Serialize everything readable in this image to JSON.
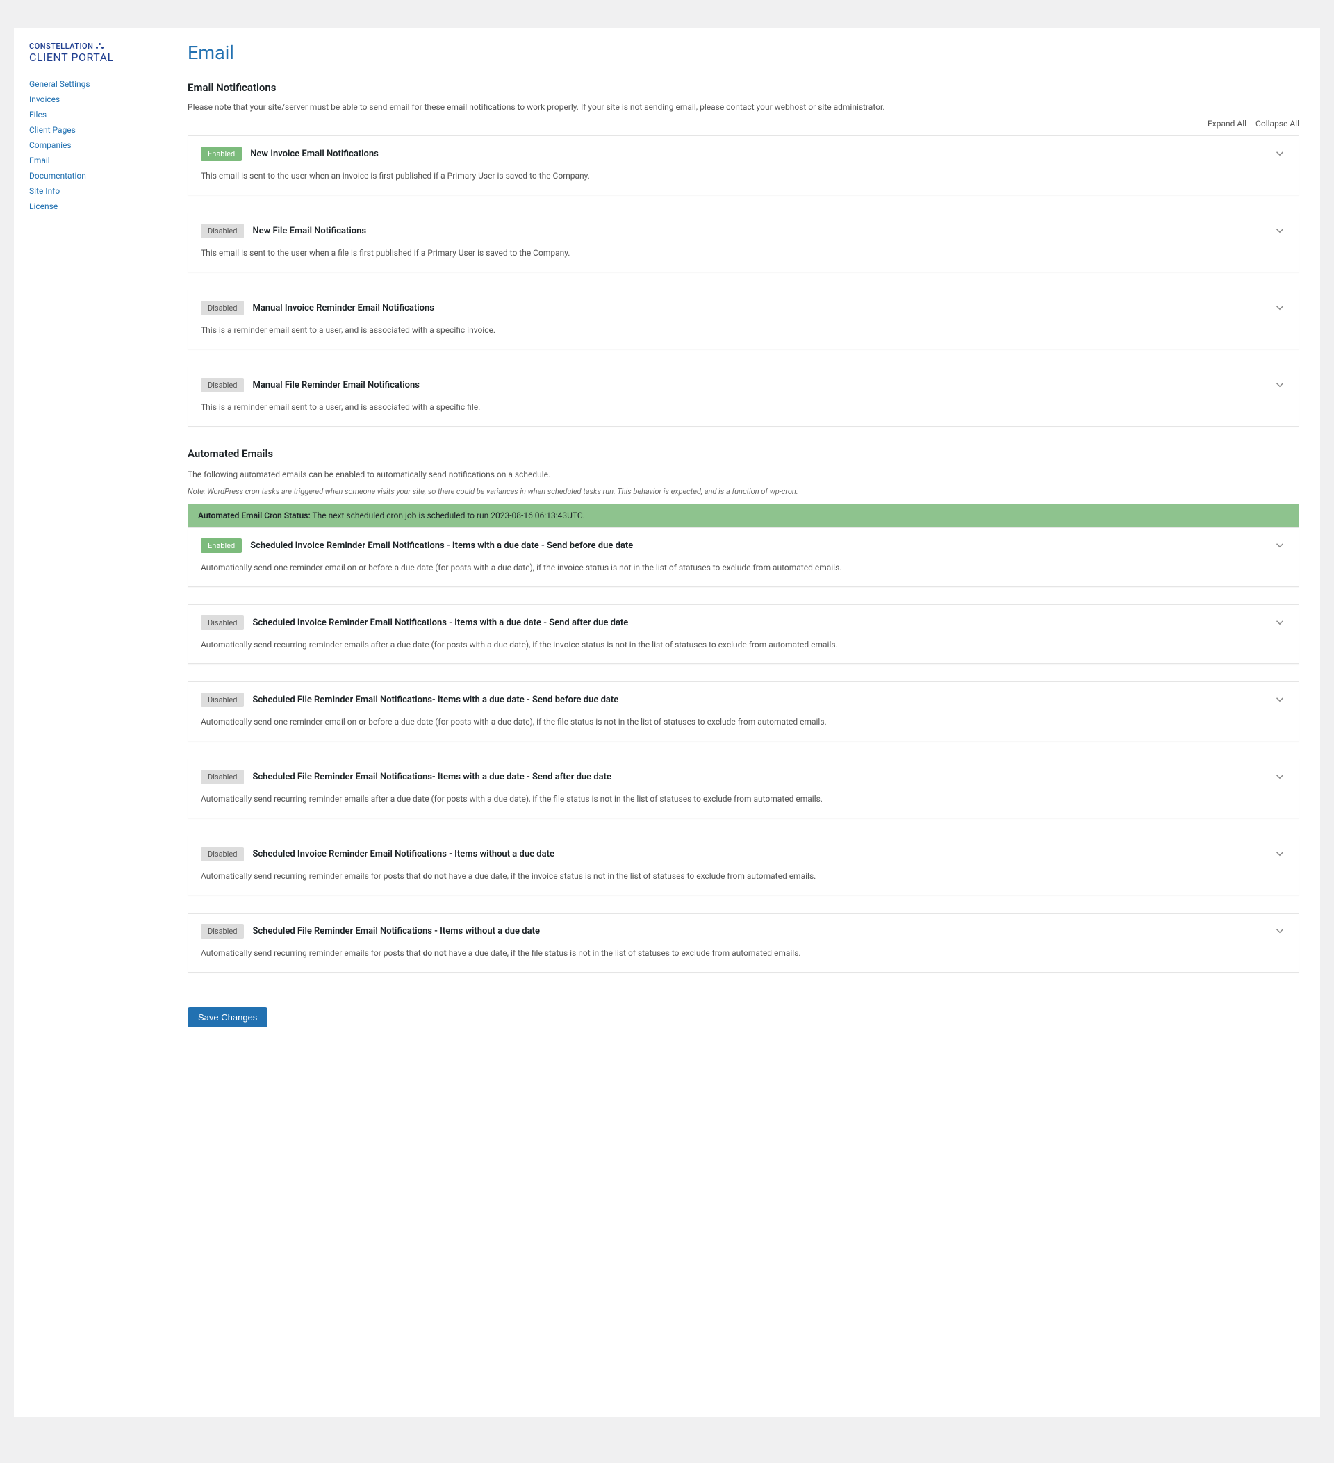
{
  "logo": {
    "top": "CONSTELLATION",
    "bottom": "CLIENT PORTAL"
  },
  "nav": [
    "General Settings",
    "Invoices",
    "Files",
    "Client Pages",
    "Companies",
    "Email",
    "Documentation",
    "Site Info",
    "License"
  ],
  "page_title": "Email",
  "section1": {
    "heading": "Email Notifications",
    "desc": "Please note that your site/server must be able to send email for these email notifications to work properly. If your site is not sending email, please contact your webhost or site administrator."
  },
  "toolbar": {
    "expand": "Expand All",
    "collapse": "Collapse All"
  },
  "badges": {
    "enabled": "Enabled",
    "disabled": "Disabled"
  },
  "panels1": [
    {
      "status": "enabled",
      "title": "New Invoice Email Notifications",
      "desc": "This email is sent to the user when an invoice is first published if a Primary User is saved to the Company."
    },
    {
      "status": "disabled",
      "title": "New File Email Notifications",
      "desc": "This email is sent to the user when a file is first published if a Primary User is saved to the Company."
    },
    {
      "status": "disabled",
      "title": "Manual Invoice Reminder Email Notifications",
      "desc": "This is a reminder email sent to a user, and is associated with a specific invoice."
    },
    {
      "status": "disabled",
      "title": "Manual File Reminder Email Notifications",
      "desc": "This is a reminder email sent to a user, and is associated with a specific file."
    }
  ],
  "section2": {
    "heading": "Automated Emails",
    "desc": "The following automated emails can be enabled to automatically send notifications on a schedule.",
    "note": "Note: WordPress cron tasks are triggered when someone visits your site, so there could be variances in when scheduled tasks run. This behavior is expected, and is a function of wp-cron."
  },
  "cron": {
    "label": "Automated Email Cron Status:",
    "text": " The next scheduled cron job is scheduled to run 2023-08-16 06:13:43UTC."
  },
  "panels2": [
    {
      "status": "enabled",
      "title": "Scheduled Invoice Reminder Email Notifications - Items with a due date - Send before due date",
      "desc": "Automatically send one reminder email on or before a due date (for posts with a due date), if the invoice status is not in the list of statuses to exclude from automated emails."
    },
    {
      "status": "disabled",
      "title": "Scheduled Invoice Reminder Email Notifications - Items with a due date - Send after due date",
      "desc": "Automatically send recurring reminder emails after a due date (for posts with a due date), if the invoice status is not in the list of statuses to exclude from automated emails."
    },
    {
      "status": "disabled",
      "title": "Scheduled File Reminder Email Notifications- Items with a due date - Send before due date",
      "desc": "Automatically send one reminder email on or before a due date (for posts with a due date), if the file status is not in the list of statuses to exclude from automated emails."
    },
    {
      "status": "disabled",
      "title": "Scheduled File Reminder Email Notifications- Items with a due date - Send after due date",
      "desc": "Automatically send recurring reminder emails after a due date (for posts with a due date), if the file status is not in the list of statuses to exclude from automated emails."
    },
    {
      "status": "disabled",
      "title": "Scheduled Invoice Reminder Email Notifications - Items without a due date",
      "desc_pre": "Automatically send recurring reminder emails for posts that ",
      "desc_bold": "do not",
      "desc_post": " have a due date, if the invoice status is not in the list of statuses to exclude from automated emails."
    },
    {
      "status": "disabled",
      "title": "Scheduled File Reminder Email Notifications - Items without a due date",
      "desc_pre": "Automatically send recurring reminder emails for posts that ",
      "desc_bold": "do not",
      "desc_post": " have a due date, if the file status is not in the list of statuses to exclude from automated emails."
    }
  ],
  "save_button": "Save Changes"
}
